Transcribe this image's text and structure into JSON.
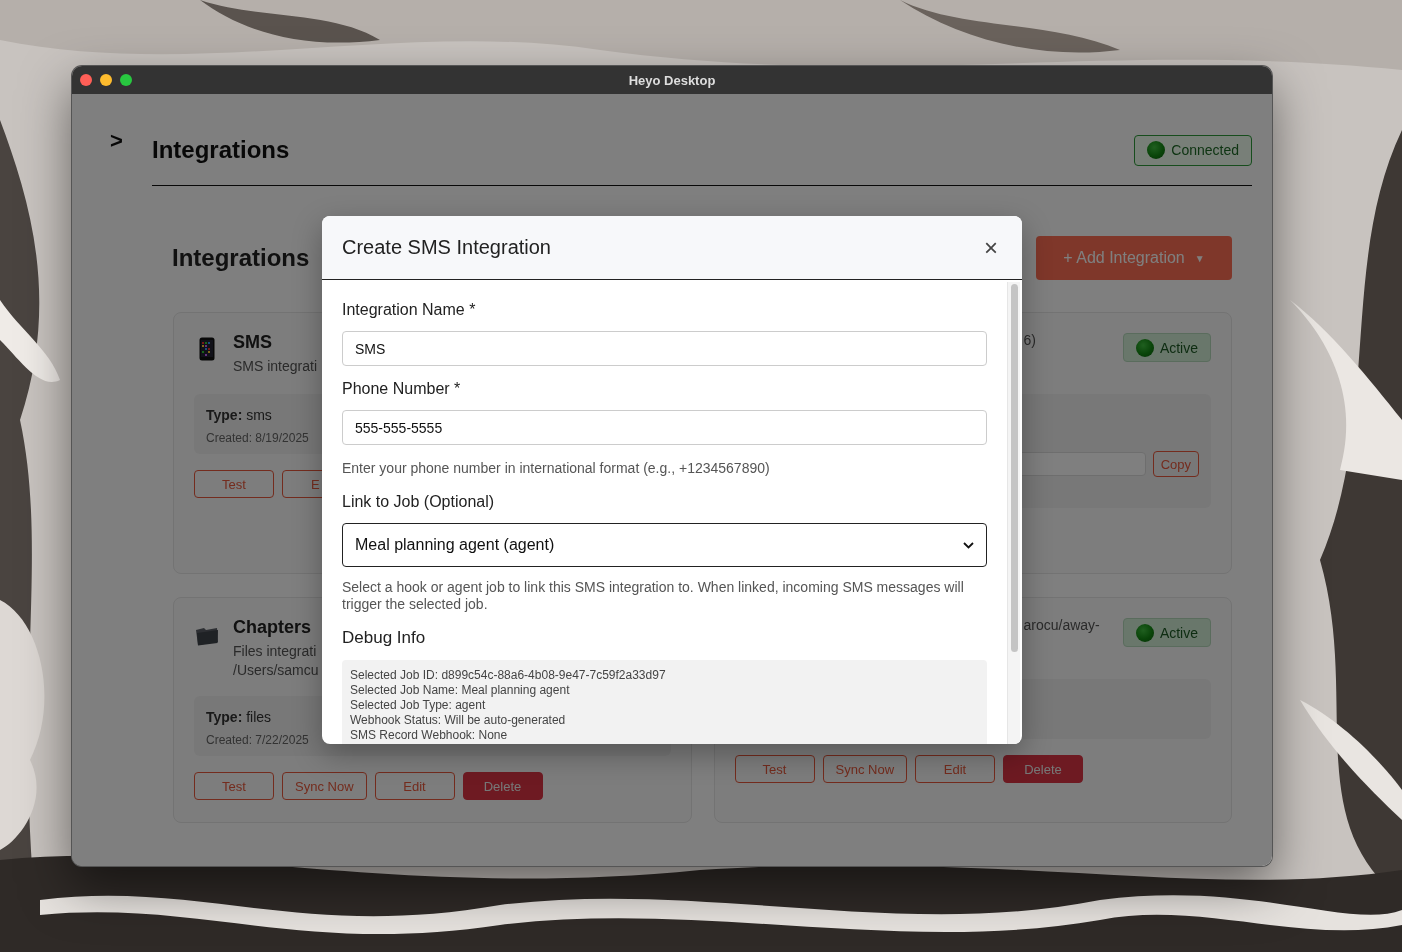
{
  "window": {
    "title": "Heyo Desktop"
  },
  "sidebar_toggle": ">",
  "header": {
    "title": "Integrations",
    "status": "Connected"
  },
  "section": {
    "title": "Integrations",
    "add_button": "+ Add Integration",
    "add_caret": "▼"
  },
  "cards": [
    {
      "kind": "sms",
      "title": "SMS",
      "description": [
        "SMS integrati"
      ],
      "details": {
        "type_label": "Type:",
        "type": "sms",
        "created": "Created: 8/19/2025"
      },
      "buttons": [
        {
          "label": "Test",
          "kind": "outline"
        },
        {
          "label": "E",
          "kind": "outline"
        }
      ]
    },
    {
      "status": "Active",
      "description": [
        "6)"
      ],
      "details": {
        "copy_button": "Copy"
      }
    },
    {
      "kind": "files",
      "title": "Chapters",
      "description": [
        "Files integrati",
        "/Users/samcu"
      ],
      "details": {
        "type_label": "Type:",
        "type": "files",
        "created": "Created: 7/22/2025"
      },
      "buttons": [
        {
          "label": "Test",
          "kind": "outline"
        },
        {
          "label": "Sync Now",
          "kind": "outline"
        },
        {
          "label": "Edit",
          "kind": "outline"
        },
        {
          "label": "Delete",
          "kind": "danger"
        }
      ]
    },
    {
      "status": "Active",
      "description": [
        "arocu/away-"
      ],
      "buttons": [
        {
          "label": "Test",
          "kind": "outline"
        },
        {
          "label": "Sync Now",
          "kind": "outline"
        },
        {
          "label": "Edit",
          "kind": "outline"
        },
        {
          "label": "Delete",
          "kind": "danger"
        }
      ]
    }
  ],
  "modal": {
    "title": "Create SMS Integration",
    "close": "×",
    "fields": [
      {
        "kind": "text",
        "label": "Integration Name *",
        "value": "SMS"
      },
      {
        "kind": "text",
        "label": "Phone Number *",
        "value": "555-555-5555",
        "help": "Enter your phone number in international format (e.g., +1234567890)"
      },
      {
        "kind": "select",
        "label": "Link to Job (Optional)",
        "value": "Meal planning agent (agent)",
        "help": "Select a hook or agent job to link this SMS integration to. When linked, incoming SMS messages will trigger the selected job."
      }
    ],
    "debug": {
      "title": "Debug Info",
      "lines": [
        "Selected Job ID: d899c54c-88a6-4b08-9e47-7c59f2a33d97",
        "Selected Job Name: Meal planning agent",
        "Selected Job Type: agent",
        "Webhook Status: Will be auto-generated",
        "SMS Record Webhook: None"
      ]
    }
  }
}
